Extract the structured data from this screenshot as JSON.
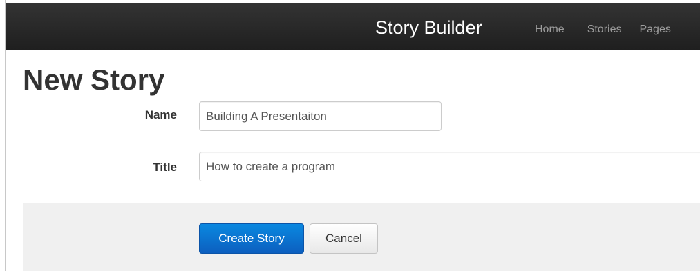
{
  "navbar": {
    "brand": "Story Builder",
    "links": [
      {
        "label": "Home"
      },
      {
        "label": "Stories"
      },
      {
        "label": "Pages"
      }
    ]
  },
  "main": {
    "title": "New Story",
    "form": {
      "name": {
        "label": "Name",
        "value": "Building A Presentaiton"
      },
      "title": {
        "label": "Title",
        "value": "How to create a program"
      }
    },
    "actions": {
      "submit_label": "Create Story",
      "cancel_label": "Cancel"
    }
  },
  "colors": {
    "navbar_bg": "#222222",
    "nav_link": "#9d9d9d",
    "primary_button": "#0a6fd1",
    "form_actions_bg": "#f0f0f0"
  }
}
